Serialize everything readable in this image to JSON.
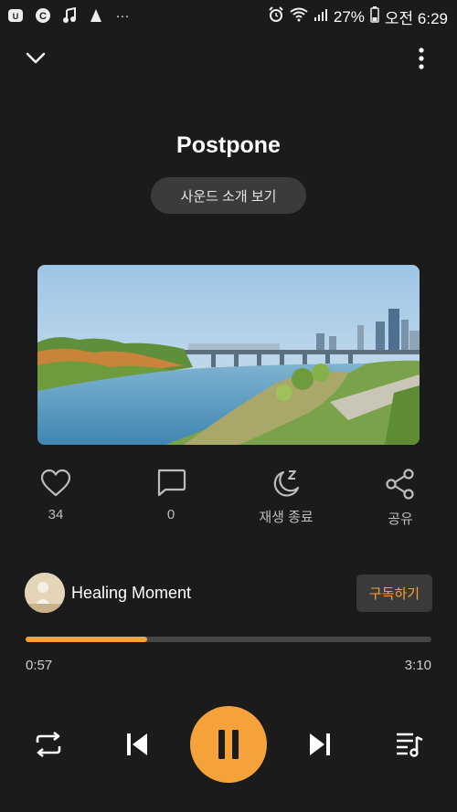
{
  "status_bar": {
    "battery": "27%",
    "clock": "오전 6:29",
    "more_indicator": "···"
  },
  "player": {
    "title": "Postpone",
    "intro_button": "사운드 소개 보기"
  },
  "actions": [
    {
      "icon": "heart-icon",
      "label": "34"
    },
    {
      "icon": "comment-icon",
      "label": "0"
    },
    {
      "icon": "sleep-timer-icon",
      "label": "재생 종료"
    },
    {
      "icon": "share-icon",
      "label": "공유"
    }
  ],
  "channel": {
    "name": "Healing Moment",
    "subscribe": "구독하기"
  },
  "progress": {
    "elapsed": "0:57",
    "total": "3:10",
    "fraction": 0.3
  },
  "colors": {
    "accent": "#f5a23a",
    "background": "#1b1b1b"
  }
}
